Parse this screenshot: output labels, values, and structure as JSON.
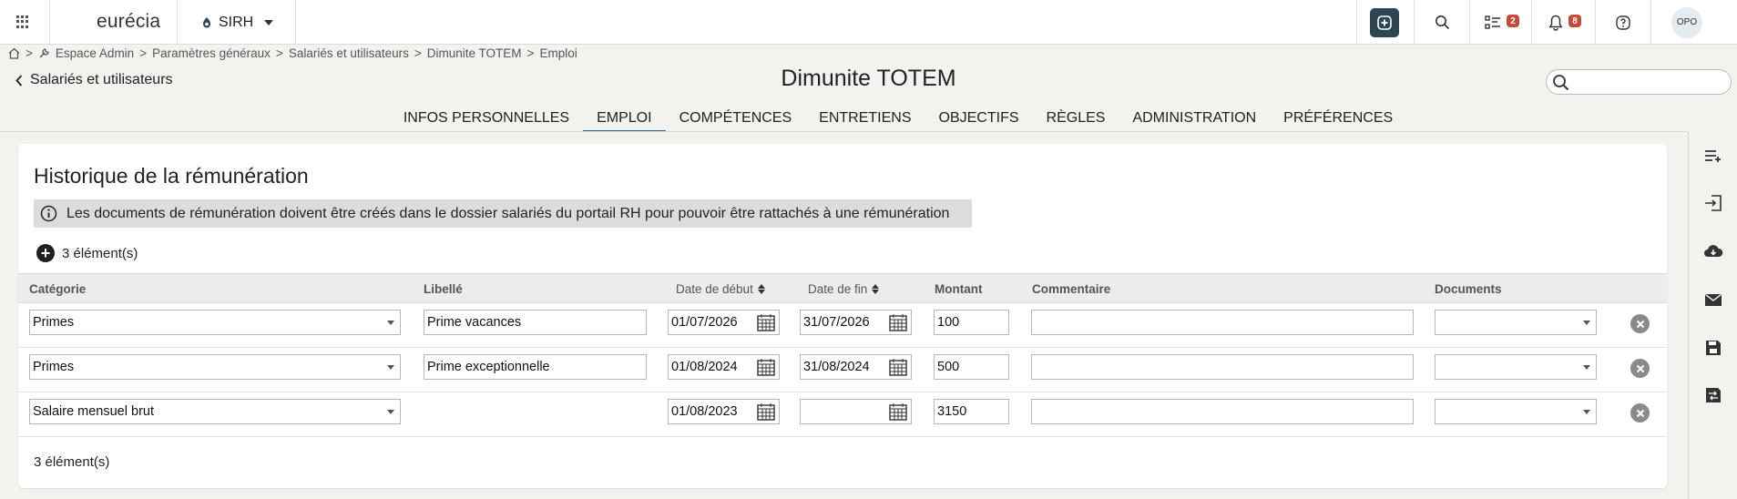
{
  "topbar": {
    "logo_text": "eurécia",
    "app_name": "SIRH",
    "tasks_badge": "2",
    "notifications_badge": "8",
    "avatar_initials": "OPO"
  },
  "breadcrumb": {
    "separator": ">",
    "items": [
      "Espace Admin",
      "Paramètres généraux",
      "Salariés et utilisateurs",
      "Dimunite TOTEM",
      "Emploi"
    ]
  },
  "header": {
    "back_label": "Salariés et utilisateurs",
    "title": "Dimunite TOTEM",
    "search_placeholder": ""
  },
  "tabs": [
    {
      "label": "INFOS PERSONNELLES",
      "active": false
    },
    {
      "label": "EMPLOI",
      "active": true
    },
    {
      "label": "COMPÉTENCES",
      "active": false
    },
    {
      "label": "ENTRETIENS",
      "active": false
    },
    {
      "label": "OBJECTIFS",
      "active": false
    },
    {
      "label": "RÈGLES",
      "active": false
    },
    {
      "label": "ADMINISTRATION",
      "active": false
    },
    {
      "label": "PRÉFÉRENCES",
      "active": false
    }
  ],
  "panel": {
    "title": "Historique de la rémunération",
    "info_message": "Les documents de rémunération doivent être créés dans le dossier salariés du portail RH pour pouvoir être rattachés à une rémunération",
    "count_label": "3 élément(s)",
    "footer_count": "3 élément(s)"
  },
  "table": {
    "columns": {
      "categorie": "Catégorie",
      "libelle": "Libellé",
      "date_debut": "Date de début",
      "date_fin": "Date de fin",
      "montant": "Montant",
      "commentaire": "Commentaire",
      "documents": "Documents"
    },
    "rows": [
      {
        "categorie": "Primes",
        "libelle": "Prime vacances",
        "date_debut": "01/07/2026",
        "date_fin": "31/07/2026",
        "montant": "100",
        "commentaire": "",
        "documents": ""
      },
      {
        "categorie": "Primes",
        "libelle": "Prime exceptionnelle",
        "date_debut": "01/08/2024",
        "date_fin": "31/08/2024",
        "montant": "500",
        "commentaire": "",
        "documents": ""
      },
      {
        "categorie": "Salaire mensuel brut",
        "libelle": "",
        "date_debut": "01/08/2023",
        "date_fin": "",
        "montant": "3150",
        "commentaire": "",
        "documents": ""
      }
    ]
  },
  "colors": {
    "accent": "#2c4652",
    "badge": "#c44a3a",
    "active_tab_underline": "#2f6b83",
    "background": "#f3f2ef"
  },
  "icons": [
    "apps-grid-icon",
    "ring-icon",
    "plus-square-icon",
    "search-icon",
    "tasks-icon",
    "bell-icon",
    "help-icon",
    "home-icon",
    "wrench-icon",
    "chevron-left-icon",
    "info-icon",
    "plus-circle-icon",
    "sort-icon",
    "calendar-icon",
    "remove-icon",
    "add-list-icon",
    "import-icon",
    "cloud-download-icon",
    "mail-icon",
    "save-icon",
    "save-transfer-icon"
  ]
}
